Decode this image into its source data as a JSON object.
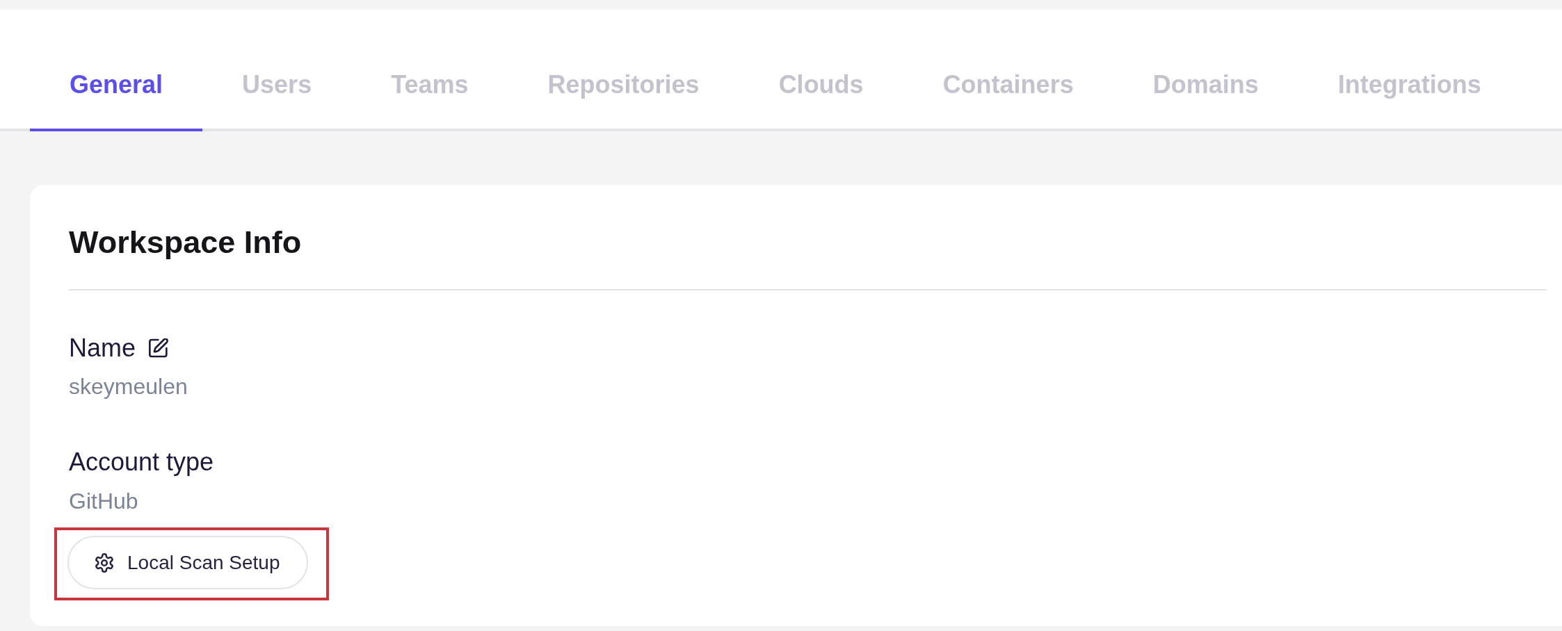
{
  "tabs": [
    {
      "label": "General",
      "selected": true
    },
    {
      "label": "Users",
      "selected": false
    },
    {
      "label": "Teams",
      "selected": false
    },
    {
      "label": "Repositories",
      "selected": false
    },
    {
      "label": "Clouds",
      "selected": false
    },
    {
      "label": "Containers",
      "selected": false
    },
    {
      "label": "Domains",
      "selected": false
    },
    {
      "label": "Integrations",
      "selected": false
    }
  ],
  "card": {
    "title": "Workspace Info",
    "fields": [
      {
        "label": "Name",
        "value": "skeymeulen",
        "editable": true
      },
      {
        "label": "Account type",
        "value": "GitHub",
        "editable": false
      }
    ],
    "button": {
      "label": "Local Scan Setup",
      "highlighted": true
    }
  }
}
